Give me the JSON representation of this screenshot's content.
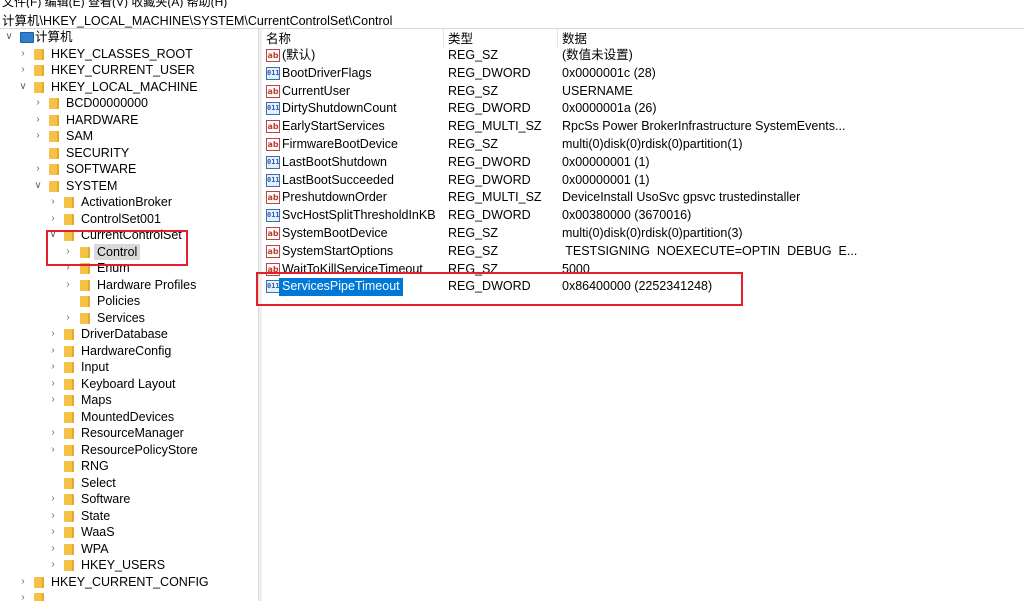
{
  "window": {
    "menu_partial": "文件(F)   编辑(E)   查看(V)   收藏夹(A)   帮助(H)",
    "address": "计算机\\HKEY_LOCAL_MACHINE\\SYSTEM\\CurrentControlSet\\Control"
  },
  "tree": {
    "root": "计算机",
    "items": [
      {
        "label": "HKEY_CLASSES_ROOT"
      },
      {
        "label": "HKEY_CURRENT_USER"
      },
      {
        "label": "HKEY_LOCAL_MACHINE"
      },
      {
        "label": "BCD00000000"
      },
      {
        "label": "HARDWARE"
      },
      {
        "label": "SAM"
      },
      {
        "label": "SECURITY"
      },
      {
        "label": "SOFTWARE"
      },
      {
        "label": "SYSTEM"
      },
      {
        "label": "ActivationBroker"
      },
      {
        "label": "ControlSet001"
      },
      {
        "label": "CurrentControlSet"
      },
      {
        "label": "Control"
      },
      {
        "label": "Enum"
      },
      {
        "label": "Hardware Profiles"
      },
      {
        "label": "Policies"
      },
      {
        "label": "Services"
      },
      {
        "label": "DriverDatabase"
      },
      {
        "label": "HardwareConfig"
      },
      {
        "label": "Input"
      },
      {
        "label": "Keyboard Layout"
      },
      {
        "label": "Maps"
      },
      {
        "label": "MountedDevices"
      },
      {
        "label": "ResourceManager"
      },
      {
        "label": "ResourcePolicyStore"
      },
      {
        "label": "RNG"
      },
      {
        "label": "Select"
      },
      {
        "label": "Software"
      },
      {
        "label": "State"
      },
      {
        "label": "WaaS"
      },
      {
        "label": "WPA"
      },
      {
        "label": "HKEY_USERS"
      },
      {
        "label": "HKEY_CURRENT_CONFIG"
      }
    ]
  },
  "list": {
    "headers": {
      "name": "名称",
      "type": "类型",
      "data": "数据"
    },
    "rows": [
      {
        "name": "(默认)",
        "type": "REG_SZ",
        "data": "(数值未设置)",
        "icon": "string-value-icon"
      },
      {
        "name": "BootDriverFlags",
        "type": "REG_DWORD",
        "data": "0x0000001c (28)",
        "icon": "binary-value-icon"
      },
      {
        "name": "CurrentUser",
        "type": "REG_SZ",
        "data": "USERNAME",
        "icon": "string-value-icon"
      },
      {
        "name": "DirtyShutdownCount",
        "type": "REG_DWORD",
        "data": "0x0000001a (26)",
        "icon": "binary-value-icon"
      },
      {
        "name": "EarlyStartServices",
        "type": "REG_MULTI_SZ",
        "data": "RpcSs Power BrokerInfrastructure SystemEvents...",
        "icon": "string-value-icon"
      },
      {
        "name": "FirmwareBootDevice",
        "type": "REG_SZ",
        "data": "multi(0)disk(0)rdisk(0)partition(1)",
        "icon": "string-value-icon"
      },
      {
        "name": "LastBootShutdown",
        "type": "REG_DWORD",
        "data": "0x00000001 (1)",
        "icon": "binary-value-icon"
      },
      {
        "name": "LastBootSucceeded",
        "type": "REG_DWORD",
        "data": "0x00000001 (1)",
        "icon": "binary-value-icon"
      },
      {
        "name": "PreshutdownOrder",
        "type": "REG_MULTI_SZ",
        "data": "DeviceInstall UsoSvc gpsvc trustedinstaller",
        "icon": "string-value-icon"
      },
      {
        "name": "SvcHostSplitThresholdInKB",
        "type": "REG_DWORD",
        "data": "0x00380000 (3670016)",
        "icon": "binary-value-icon"
      },
      {
        "name": "SystemBootDevice",
        "type": "REG_SZ",
        "data": "multi(0)disk(0)rdisk(0)partition(3)",
        "icon": "string-value-icon"
      },
      {
        "name": "SystemStartOptions",
        "type": "REG_SZ",
        "data": " TESTSIGNING  NOEXECUTE=OPTIN  DEBUG  E...",
        "icon": "string-value-icon"
      },
      {
        "name": "WaitToKillServiceTimeout",
        "type": "REG_SZ",
        "data": "5000",
        "icon": "string-value-icon"
      },
      {
        "name": "ServicesPipeTimeout",
        "type": "REG_DWORD",
        "data": "0x86400000 (2252341248)",
        "icon": "binary-value-icon"
      }
    ]
  },
  "colors": {
    "selection": "#0078d7",
    "highlight_box": "#e31e2d",
    "folder": "#f5c247"
  }
}
